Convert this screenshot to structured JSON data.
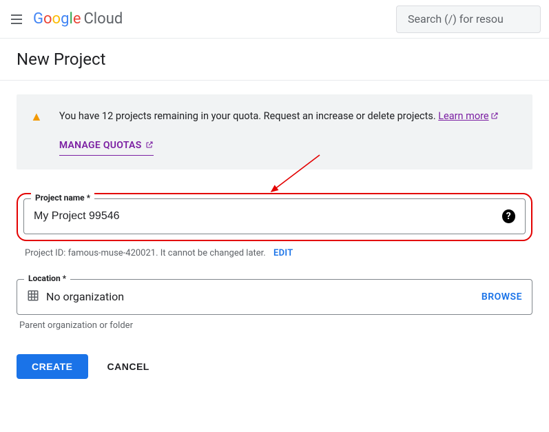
{
  "header": {
    "logo_cloud": "Cloud",
    "search_placeholder": "Search (/) for resou"
  },
  "page": {
    "title": "New Project"
  },
  "notice": {
    "text_a": "You have 12 projects remaining in your quota. Request an increase or delete projects. ",
    "learn_more": "Learn more",
    "manage_quotas": "MANAGE QUOTAS"
  },
  "form": {
    "project_name_label": "Project name *",
    "project_name_value": "My Project 99546",
    "project_id_prefix": "Project ID: ",
    "project_id_value": "famous-muse-420021",
    "project_id_suffix": ". It cannot be changed later.",
    "edit_label": "EDIT",
    "location_label": "Location *",
    "location_value": "No organization",
    "browse_label": "BROWSE",
    "location_helper": "Parent organization or folder"
  },
  "actions": {
    "create": "CREATE",
    "cancel": "CANCEL"
  }
}
